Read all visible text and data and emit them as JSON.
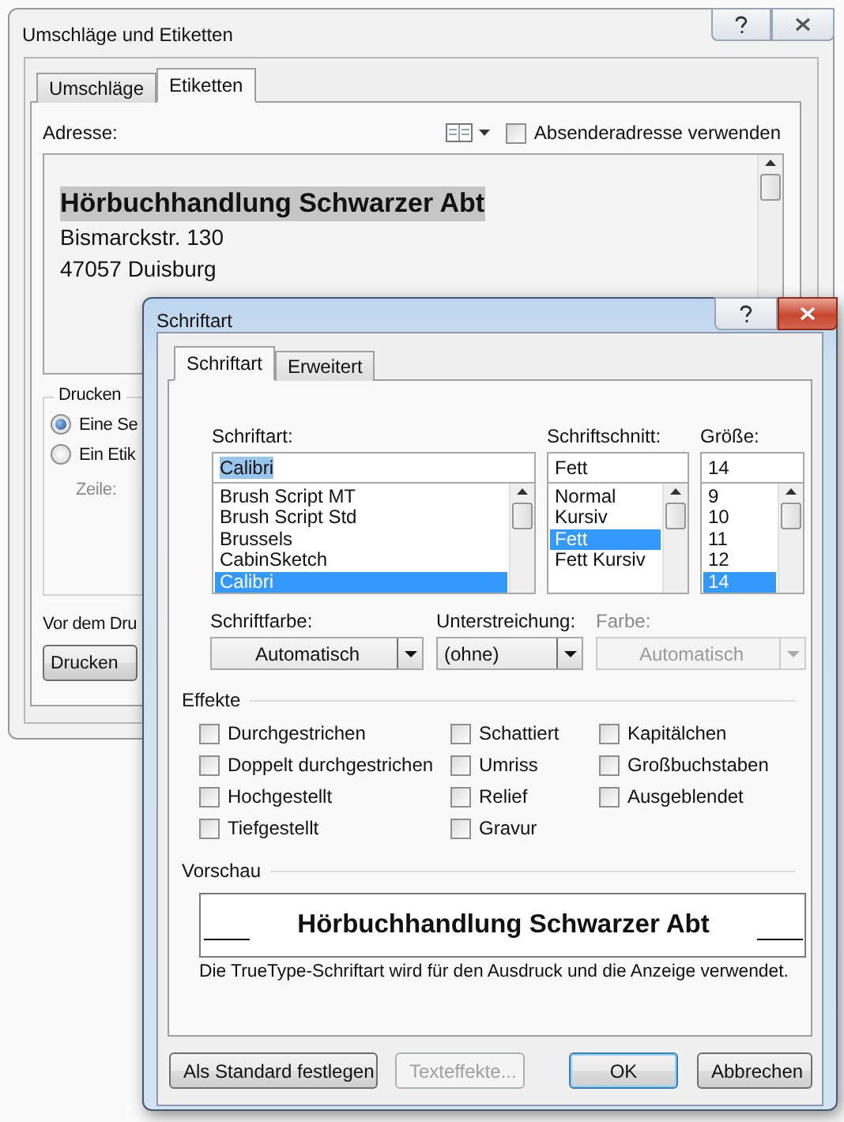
{
  "address_dialog": {
    "title": "Umschläge und Etiketten",
    "tabs": [
      {
        "label": "Umschläge",
        "selected": false
      },
      {
        "label": "Etiketten",
        "selected": true
      }
    ],
    "address_label": "Adresse:",
    "sender_checkbox": {
      "label": "Absenderadresse verwenden",
      "checked": false
    },
    "address_lines": [
      {
        "text": "Hörbuchhandlung Schwarzer Abt",
        "kind": "highlighted"
      },
      {
        "text": "Bismarckstr. 130",
        "kind": "plain"
      },
      {
        "text": "47057 Duisburg",
        "kind": "plain"
      }
    ],
    "print_group": {
      "title": "Drucken",
      "options": [
        {
          "label": "Eine Se",
          "selected": true
        },
        {
          "label": "Ein Etik",
          "selected": false
        }
      ],
      "row_label": "Zeile:"
    },
    "before_print_label": "Vor dem Dru",
    "print_button": "Drucken"
  },
  "font_dialog": {
    "title": "Schriftart",
    "tabs": [
      {
        "label": "Schriftart",
        "selected": true
      },
      {
        "label": "Erweitert",
        "selected": false
      }
    ],
    "font": {
      "label": "Schriftart:",
      "value": "Calibri",
      "highlighted": true,
      "items": [
        {
          "label": "Brush Script MT",
          "selected": false
        },
        {
          "label": "Brush Script Std",
          "selected": false
        },
        {
          "label": "Brussels",
          "selected": false
        },
        {
          "label": "CabinSketch",
          "selected": false
        },
        {
          "label": "Calibri",
          "selected": true
        }
      ]
    },
    "style": {
      "label": "Schriftschnitt:",
      "value": "Fett",
      "highlighted": false,
      "items": [
        {
          "label": "Normal",
          "selected": false
        },
        {
          "label": "Kursiv",
          "selected": false
        },
        {
          "label": "Fett",
          "selected": true
        },
        {
          "label": "Fett Kursiv",
          "selected": false
        }
      ]
    },
    "size": {
      "label": "Größe:",
      "value": "14",
      "highlighted": false,
      "items": [
        {
          "label": "9",
          "selected": false
        },
        {
          "label": "10",
          "selected": false
        },
        {
          "label": "11",
          "selected": false
        },
        {
          "label": "12",
          "selected": false
        },
        {
          "label": "14",
          "selected": true
        }
      ]
    },
    "dropdowns": [
      {
        "label": "Schriftfarbe:",
        "value": "Automatisch",
        "disabled": false
      },
      {
        "label": "Unterstreichung:",
        "value": "(ohne)",
        "disabled": false
      },
      {
        "label": "Farbe:",
        "value": "Automatisch",
        "disabled": true
      }
    ],
    "effects_title": "Effekte",
    "effect_columns": [
      [
        {
          "label": "Durchgestrichen",
          "checked": false
        },
        {
          "label": "Doppelt durchgestrichen",
          "checked": false
        },
        {
          "label": "Hochgestellt",
          "checked": false
        },
        {
          "label": "Tiefgestellt",
          "checked": false
        }
      ],
      [
        {
          "label": "Schattiert",
          "checked": false
        },
        {
          "label": "Umriss",
          "checked": false
        },
        {
          "label": "Relief",
          "checked": false
        },
        {
          "label": "Gravur",
          "checked": false
        }
      ],
      [
        {
          "label": "Kapitälchen",
          "checked": false
        },
        {
          "label": "Großbuchstaben",
          "checked": false
        },
        {
          "label": "Ausgeblendet",
          "checked": false
        }
      ]
    ],
    "preview_title": "Vorschau",
    "preview_text": "Hörbuchhandlung Schwarzer Abt",
    "note": "Die TrueType-Schriftart wird für den Ausdruck und die Anzeige verwendet.",
    "buttons": [
      {
        "label": "Als Standard festlegen",
        "kind": "normal",
        "disabled": false
      },
      {
        "label": "Texteffekte...",
        "kind": "normal",
        "disabled": true
      },
      {
        "label": "OK",
        "kind": "default",
        "disabled": false
      },
      {
        "label": "Abbrechen",
        "kind": "normal",
        "disabled": false
      }
    ]
  }
}
